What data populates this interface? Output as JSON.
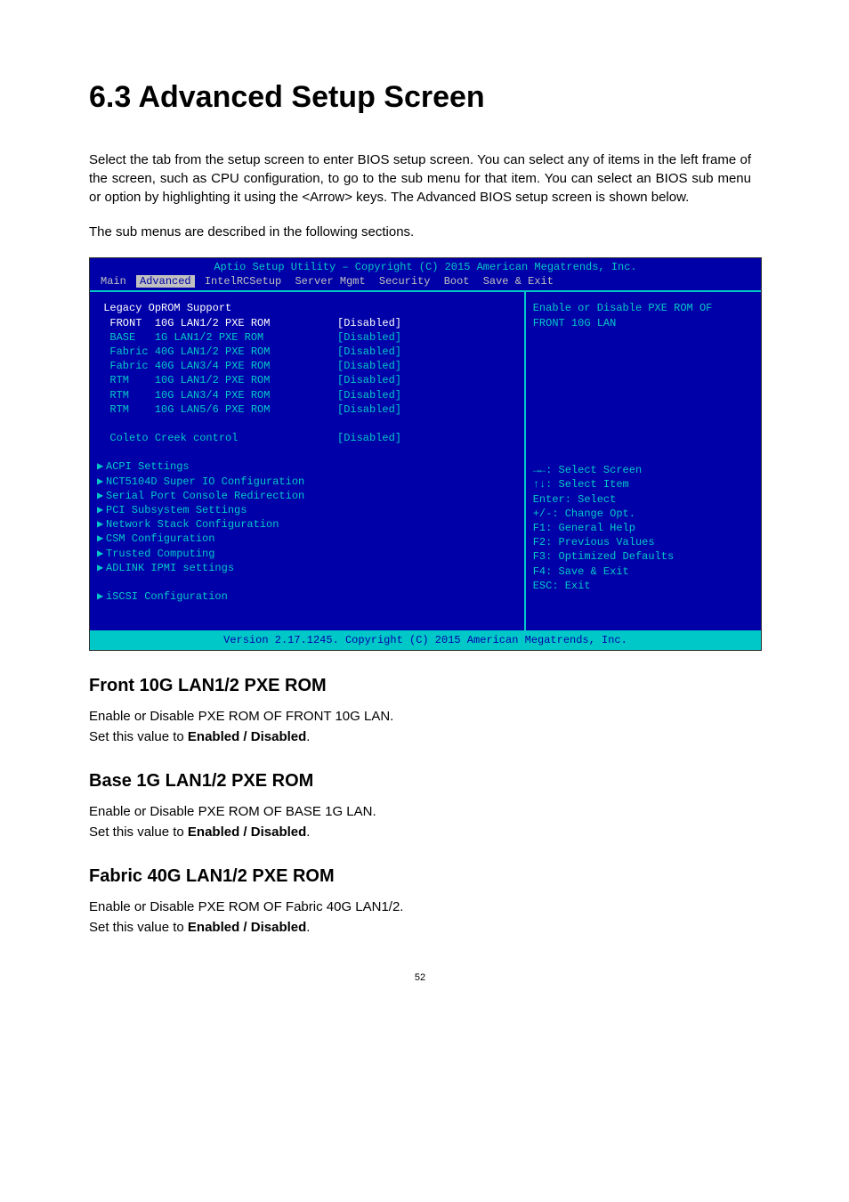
{
  "heading": "6.3 Advanced Setup Screen",
  "intro1": "Select the               tab from the setup screen to enter               BIOS setup screen. You can select any of items in the left frame of the screen, such as CPU configuration, to go to the sub menu for that item. You can select an               BIOS sub menu or option by highlighting it using the <Arrow> keys. The Advanced BIOS setup screen is shown below.",
  "intro2": "The sub menus are described in the following sections.",
  "bios": {
    "title": "Aptio Setup Utility – Copyright (C) 2015 American Megatrends, Inc.",
    "version": "Version 2.17.1245. Copyright (C) 2015 American Megatrends, Inc.",
    "menu": [
      "Main",
      "Advanced",
      "IntelRCSetup",
      "Server Mgmt",
      "Security",
      "Boot",
      "Save & Exit"
    ],
    "active_menu": 1,
    "section_heading": "Legacy OpROM Support",
    "opts": [
      {
        "label": "FRONT  10G LAN1/2 PXE ROM",
        "value": "[Disabled]",
        "hl": true
      },
      {
        "label": "BASE   1G LAN1/2 PXE ROM",
        "value": "[Disabled]",
        "hl": false
      },
      {
        "label": "Fabric 40G LAN1/2 PXE ROM",
        "value": "[Disabled]",
        "hl": false
      },
      {
        "label": "Fabric 40G LAN3/4 PXE ROM",
        "value": "[Disabled]",
        "hl": false
      },
      {
        "label": "RTM    10G LAN1/2 PXE ROM",
        "value": "[Disabled]",
        "hl": false
      },
      {
        "label": "RTM    10G LAN3/4 PXE ROM",
        "value": "[Disabled]",
        "hl": false
      },
      {
        "label": "RTM    10G LAN5/6 PXE ROM",
        "value": "[Disabled]",
        "hl": false
      }
    ],
    "coleto": {
      "label": "Coleto Creek control",
      "value": "[Disabled]"
    },
    "subs": [
      "ACPI Settings",
      "NCT5104D Super IO Configuration",
      "Serial Port Console Redirection",
      "PCI Subsystem Settings",
      "Network Stack Configuration",
      "CSM Configuration",
      "Trusted Computing",
      "ADLINK IPMI settings"
    ],
    "iscsi": "iSCSI Configuration",
    "help_top": [
      "Enable or Disable PXE ROM OF",
      "FRONT 10G LAN"
    ],
    "help_keys": [
      "→←: Select Screen",
      "↑↓: Select Item",
      "Enter: Select",
      "+/-: Change Opt.",
      "F1: General Help",
      "F2: Previous Values",
      "F3: Optimized Defaults",
      "F4: Save & Exit",
      "ESC: Exit"
    ]
  },
  "sections": [
    {
      "title": "Front 10G LAN1/2 PXE ROM",
      "line1": "Enable or Disable PXE ROM OF FRONT 10G LAN.",
      "line2_prefix": "Set this value to ",
      "line2_bold": "Enabled / Disabled",
      "line2_suffix": "."
    },
    {
      "title": "Base 1G LAN1/2 PXE ROM",
      "line1": "Enable or Disable PXE ROM OF BASE 1G LAN.",
      "line2_prefix": "Set this value to ",
      "line2_bold": "Enabled / Disabled",
      "line2_suffix": "."
    },
    {
      "title": "Fabric 40G LAN1/2 PXE ROM",
      "line1": "Enable or Disable PXE ROM OF Fabric 40G LAN1/2.",
      "line2_prefix": "Set this value to ",
      "line2_bold": "Enabled / Disabled",
      "line2_suffix": "."
    }
  ],
  "page_number": "52"
}
